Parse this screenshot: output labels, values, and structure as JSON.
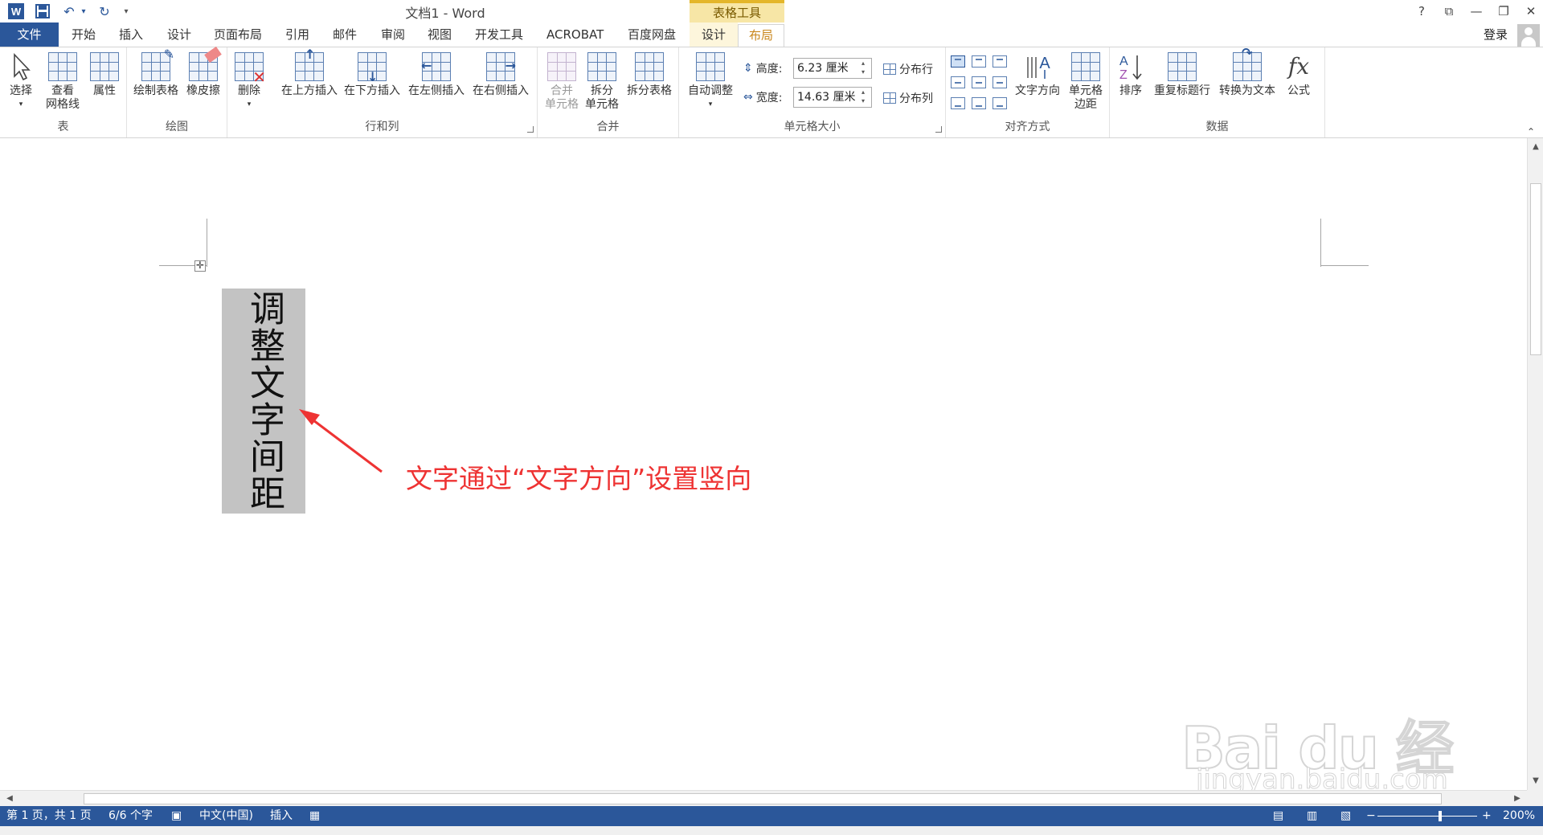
{
  "app": {
    "title": "文档1 - Word",
    "context_group": "表格工具",
    "window_buttons": [
      "?",
      "⧉",
      "—",
      "❐",
      "✕"
    ]
  },
  "colors": {
    "accent": "#2b579a",
    "context": "#f7e6a6",
    "active_tab_text": "#c9861b",
    "annotation": "#ee3333"
  },
  "tabs": {
    "file": "文件",
    "items": [
      "开始",
      "插入",
      "设计",
      "页面布局",
      "引用",
      "邮件",
      "审阅",
      "视图",
      "开发工具",
      "ACROBAT",
      "百度网盘"
    ],
    "ctx_design": "设计",
    "ctx_layout": "布局",
    "signin": "登录"
  },
  "ribbon": {
    "groups": {
      "table": "表",
      "draw": "绘图",
      "rows_cols": "行和列",
      "merge": "合并",
      "cell_size": "单元格大小",
      "alignment": "对齐方式",
      "data": "数据"
    },
    "select": "选择",
    "gridlines_1": "查看",
    "gridlines_2": "网格线",
    "properties": "属性",
    "draw_table": "绘制表格",
    "eraser": "橡皮擦",
    "delete": "删除",
    "insert_above": "在上方插入",
    "insert_below": "在下方插入",
    "insert_left": "在左侧插入",
    "insert_right": "在右侧插入",
    "merge_1": "合并",
    "merge_2": "单元格",
    "split_1": "拆分",
    "split_2": "单元格",
    "split_table": "拆分表格",
    "autofit": "自动调整",
    "height_label": "高度:",
    "height_value": "6.23 厘米",
    "width_label": "宽度:",
    "width_value": "14.63 厘米",
    "distribute_rows": "分布行",
    "distribute_cols": "分布列",
    "text_direction": "文字方向",
    "cell_margins_1": "单元格",
    "cell_margins_2": "边距",
    "sort": "排序",
    "repeat_header": "重复标题行",
    "convert_text": "转换为文本",
    "formula": "公式"
  },
  "document": {
    "cell_text": "调整文字间距",
    "annotation": "文字通过“文字方向”设置竖向",
    "watermark_logo": "Bai du 经验",
    "watermark_url": "jingyan.baidu.com"
  },
  "status": {
    "page": "第 1 页，共 1 页",
    "words": "6/6 个字",
    "language": "中文(中国)",
    "mode": "插入",
    "zoom": "200%",
    "zoom_percent": 200
  }
}
